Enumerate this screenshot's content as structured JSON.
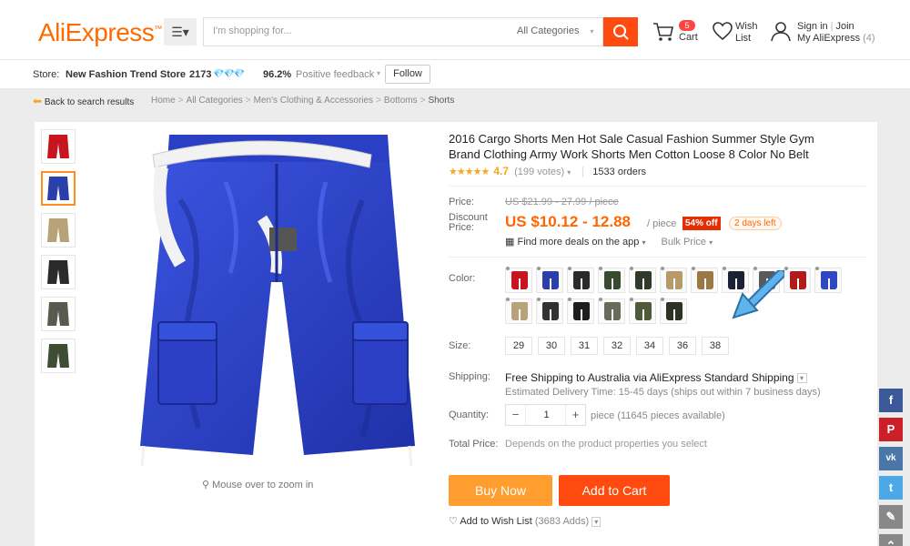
{
  "header": {
    "logo": "AliExpress",
    "logo_tm": "™",
    "search_placeholder": "I'm shopping for...",
    "category": "All Categories",
    "cart_count": "5",
    "cart_label": "Cart",
    "wish_label_1": "Wish",
    "wish_label_2": "List",
    "sign_in": "Sign in",
    "join": "Join",
    "my_aliexpress": "My AliExpress",
    "my_count": "(4)"
  },
  "store": {
    "label": "Store:",
    "name": "New Fashion Trend Store",
    "score": "2173",
    "feedback_pct": "96.2%",
    "feedback_label": "Positive feedback",
    "follow": "Follow"
  },
  "breadcrumb": {
    "back": "Back to search results",
    "items": [
      "Home",
      "All Categories",
      "Men's Clothing & Accessories",
      "Bottoms",
      "Shorts"
    ]
  },
  "product": {
    "title": "2016 Cargo Shorts Men Hot Sale Casual Fashion Summer Style Gym Brand Clothing Army Work Shorts Men Cotton Loose 8 Color No Belt",
    "stars": "★★★★★",
    "rating": "4.7",
    "votes": "(199 votes)",
    "orders": "1533 orders",
    "price_label": "Price:",
    "orig_price": "US $21.99 - 27.99 / piece",
    "discount_label_1": "Discount",
    "discount_label_2": "Price:",
    "discount_price": "US $10.12 - 12.88",
    "per_piece": "/ piece",
    "off_badge": "54% off",
    "days_left": "2 days left",
    "deals": "Find more deals on the app",
    "bulk": "Bulk Price",
    "color_label": "Color:",
    "colors": [
      "#c8141e",
      "#2a3fa8",
      "#2b2b2b",
      "#3a4a2e",
      "#2f3a2a",
      "#b79a6a",
      "#9a7a44",
      "#1a2233",
      "#5a5a5a",
      "#b01c1c",
      "#2f47c0",
      "#b8a27a",
      "#323232",
      "#1e1e1e",
      "#6a6a5a",
      "#4e5a3a",
      "#2c3324"
    ],
    "size_label": "Size:",
    "sizes": [
      "29",
      "30",
      "31",
      "32",
      "34",
      "36",
      "38"
    ],
    "shipping_label": "Shipping:",
    "shipping": "Free Shipping to Australia via AliExpress Standard Shipping",
    "delivery": "Estimated Delivery Time: 15-45 days (ships out within 7 business days)",
    "quantity_label": "Quantity:",
    "quantity": "1",
    "qty_note": "piece (11645 pieces available)",
    "total_label": "Total Price:",
    "total_note": "Depends on the product properties you select",
    "buy_now": "Buy Now",
    "add_to_cart": "Add to Cart",
    "wish_list": "Add to Wish List",
    "wish_count": "(3683 Adds)",
    "zoom_hint": "Mouse over to zoom in",
    "thumb_colors": [
      "#c8141e",
      "#2a3fa8",
      "#b8a27a",
      "#2b2b2b",
      "#5a5a4e",
      "#3f4d33"
    ]
  },
  "social": [
    "f",
    "P",
    "vk",
    "t"
  ]
}
